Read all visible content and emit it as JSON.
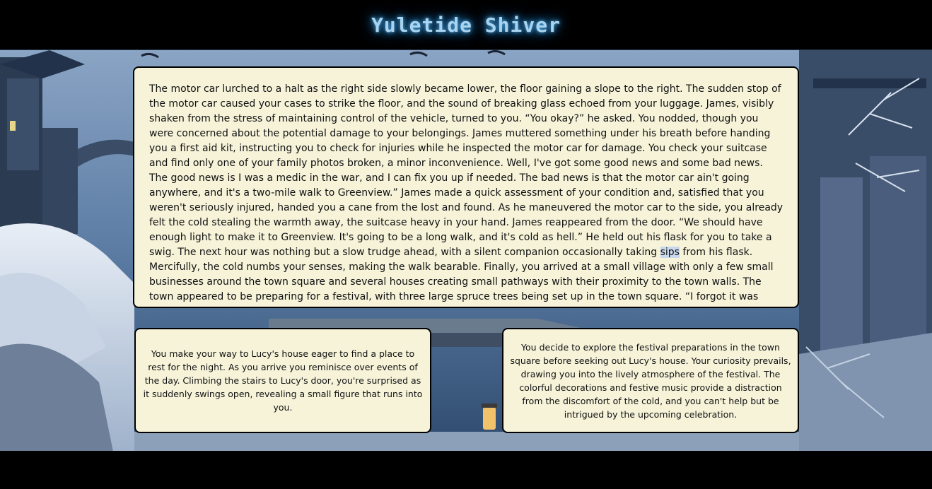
{
  "app": {
    "title": "Yuletide Shiver"
  },
  "story": {
    "before_highlight": "The motor car lurched to a halt as the right side slowly became lower, the floor gaining a slope to the right. The sudden stop of the motor car caused your cases to strike the floor, and the sound of breaking glass echoed from your luggage. James, visibly shaken from the stress of maintaining control of the vehicle, turned to you. “You okay?” he asked. You nodded, though you were concerned about the potential damage to your belongings. James muttered something under his breath before handing you a first aid kit, instructing you to check for injuries while he inspected the motor car for damage. You check your suitcase and find only one of your family photos broken, a minor inconvenience. Well, I've got some good news and some bad news. The good news is I was a medic in the war, and I can fix you up if needed. The bad news is that the motor car ain't going anywhere, and it's a two-mile walk to Greenview.” James made a quick assessment of your condition and, satisfied that you weren't seriously injured, handed you a cane from the lost and found. As he maneuvered the motor car to the side, you already felt the cold stealing the warmth away, the suitcase heavy in your hand. James reappeared from the door. “We should have enough light to make it to Greenview. It's going to be a long walk, and it's cold as hell.” He held out his flask for you to take a swig. The next hour was nothing but a slow trudge ahead, with a silent companion occasionally taking ",
    "highlight": "sips",
    "after_highlight": " from his flask. Mercifully, the cold numbs your senses, making the walk bearable. Finally, you arrived at a small village with only a few small businesses around the town square and several houses creating small pathways with their proximity to the town walls. The town appeared to be preparing for a festival, with three large spruce trees being set up in the town square. “I forgot it was festival time. Well, at least there will be"
  },
  "choices": [
    {
      "text": "You make your way to Lucy's house eager to find a place to rest for the night. As you arrive you reminisce over events of the day. Climbing the stairs to Lucy's door, you're surprised as it suddenly swings open, revealing a small figure that runs into you."
    },
    {
      "text": "You decide to explore the festival preparations in the town square before seeking out Lucy's house. Your curiosity prevails, drawing you into the lively atmosphere of the festival. The colorful decorations and festive music provide a distraction from the discomfort of the cold, and you can't help but be intrigued by the upcoming celebration."
    }
  ],
  "colors": {
    "title_glow": "#4fa7df",
    "panel_bg": "#f6f3d9",
    "highlight": "#c8d9ee"
  }
}
